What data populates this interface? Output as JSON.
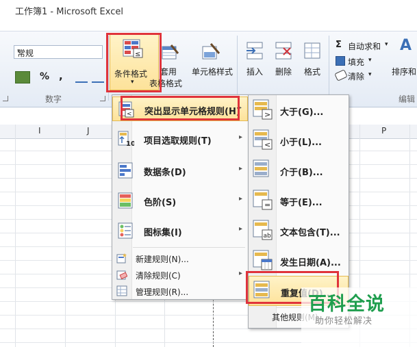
{
  "window": {
    "title": "工作簿1 - Microsoft Excel"
  },
  "ribbon": {
    "number_format": "常规",
    "percent_symbol": "%",
    "comma_symbol": ",",
    "group_number_label": "数字",
    "group_edit_label": "编辑",
    "conditional_format_label": "条件格式",
    "table_format_line1": "套用",
    "table_format_line2": "表格格式",
    "cell_style_label": "单元格样式",
    "insert_label": "插入",
    "delete_label": "删除",
    "format_label": "格式",
    "autosum_label": "自动求和",
    "fill_label": "填充",
    "clear_label": "清除",
    "sort_label": "排序和",
    "sigma_symbol": "Σ",
    "sort_symbol": "A"
  },
  "columns": [
    "I",
    "J",
    "P"
  ],
  "menu_main": {
    "items": [
      {
        "label": "突出显示单元格规则(H)"
      },
      {
        "label": "项目选取规则(T)"
      },
      {
        "label": "数据条(D)"
      },
      {
        "label": "色阶(S)"
      },
      {
        "label": "图标集(I)"
      }
    ],
    "small_items": [
      {
        "label": "新建规则(N)..."
      },
      {
        "label": "清除规则(C)"
      },
      {
        "label": "管理规则(R)..."
      }
    ]
  },
  "menu_sub": {
    "items": [
      {
        "label": "大于(G)..."
      },
      {
        "label": "小于(L)..."
      },
      {
        "label": "介于(B)..."
      },
      {
        "label": "等于(E)..."
      },
      {
        "label": "文本包含(T)..."
      },
      {
        "label": "发生日期(A)..."
      },
      {
        "label": "重复值(D)..."
      }
    ],
    "more_label": "其他规则(M)..."
  },
  "watermark": {
    "brand": "百科全说",
    "slogan": "助你轻松解决"
  },
  "colors": {
    "highlight_border": "#e0333b",
    "menu_highlight": "#fde29a",
    "brand_green": "#1f9e4e"
  }
}
